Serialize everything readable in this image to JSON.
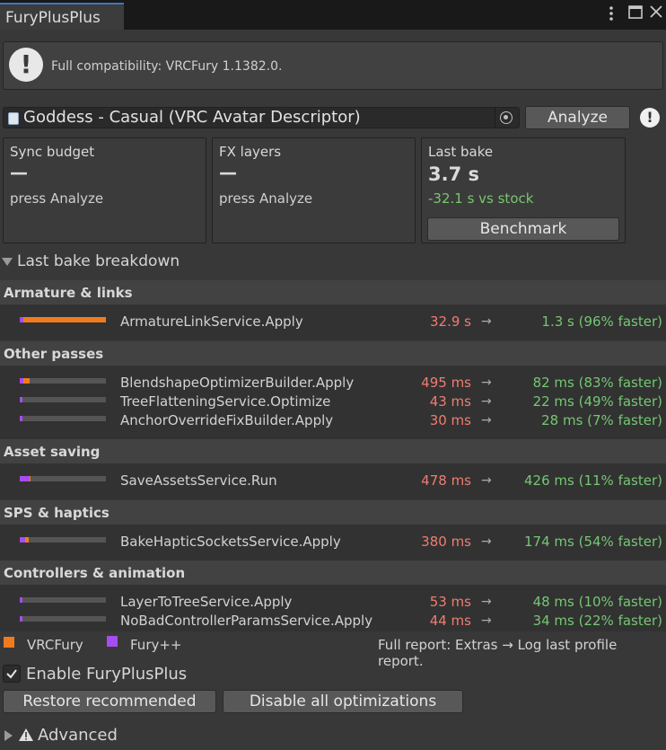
{
  "window": {
    "tab_title": "FuryPlusPlus",
    "menu_icon": "kebab-menu-icon",
    "maximize_icon": "maximize-icon",
    "close_icon": "close-icon"
  },
  "helpbox": {
    "text": "Full compatibility: VRCFury 1.1382.0.",
    "icon": "info-exclamation-icon"
  },
  "avatar_field": {
    "value": "Goddess - Casual (VRC Avatar Descriptor)",
    "picker_icon": "object-picker-icon"
  },
  "toolbar": {
    "analyze_label": "Analyze",
    "warn_icon": "warning-exclamation-icon"
  },
  "stats": {
    "sync_budget": {
      "title": "Sync budget",
      "value": "—",
      "sub": "press Analyze"
    },
    "fx_layers": {
      "title": "FX layers",
      "value": "—",
      "sub": "press Analyze"
    },
    "last_bake": {
      "title": "Last bake",
      "value": "3.7 s",
      "delta": "-32.1 s vs stock",
      "benchmark_label": "Benchmark"
    }
  },
  "breakdown": {
    "label": "Last bake breakdown",
    "sections": [
      {
        "title": "Armature & links",
        "rows": [
          {
            "name": "ArmatureLinkService.Apply",
            "before": "32.9 s",
            "after": "1.3 s (96% faster)",
            "fpp": 0.04,
            "vrc": 0.96
          }
        ]
      },
      {
        "title": "Other passes",
        "rows": [
          {
            "name": "BlendshapeOptimizerBuilder.Apply",
            "before": "495 ms",
            "after": "82 ms (83% faster)",
            "fpp": 0.04,
            "vrc": 0.07
          },
          {
            "name": "TreeFlatteningService.Optimize",
            "before": "43 ms",
            "after": "22 ms (49% faster)",
            "fpp": 0.03,
            "vrc": 0.0
          },
          {
            "name": "AnchorOverrideFixBuilder.Apply",
            "before": "30 ms",
            "after": "28 ms (7% faster)",
            "fpp": 0.03,
            "vrc": 0.0
          }
        ]
      },
      {
        "title": "Asset saving",
        "rows": [
          {
            "name": "SaveAssetsService.Run",
            "before": "478 ms",
            "after": "426 ms (11% faster)",
            "fpp": 0.11,
            "vrc": 0.01
          }
        ]
      },
      {
        "title": "SPS & haptics",
        "rows": [
          {
            "name": "BakeHapticSocketsService.Apply",
            "before": "380 ms",
            "after": "174 ms (54% faster)",
            "fpp": 0.06,
            "vrc": 0.04
          }
        ]
      },
      {
        "title": "Controllers & animation",
        "rows": [
          {
            "name": "LayerToTreeService.Apply",
            "before": "53 ms",
            "after": "48 ms (10% faster)",
            "fpp": 0.03,
            "vrc": 0.0
          },
          {
            "name": "NoBadControllerParamsService.Apply",
            "before": "44 ms",
            "after": "34 ms (22% faster)",
            "fpp": 0.03,
            "vrc": 0.0
          }
        ]
      }
    ],
    "arrow": "→"
  },
  "legend": {
    "vrcfury": {
      "label": "VRCFury",
      "color": "#f07b1e"
    },
    "furypp": {
      "label": "Fury++",
      "color": "#a64cf0"
    },
    "footer_note": "Full report: Extras → Log last profile report."
  },
  "enable": {
    "label": "Enable FuryPlusPlus",
    "checked": true
  },
  "buttons": {
    "restore": "Restore recommended",
    "disable_all": "Disable all optimizations"
  },
  "advanced": {
    "label": "Advanced",
    "icon": "warning-triangle-icon"
  },
  "colors": {
    "before": "#ef7d70",
    "after": "#74c773",
    "delta": "#78c66e"
  }
}
